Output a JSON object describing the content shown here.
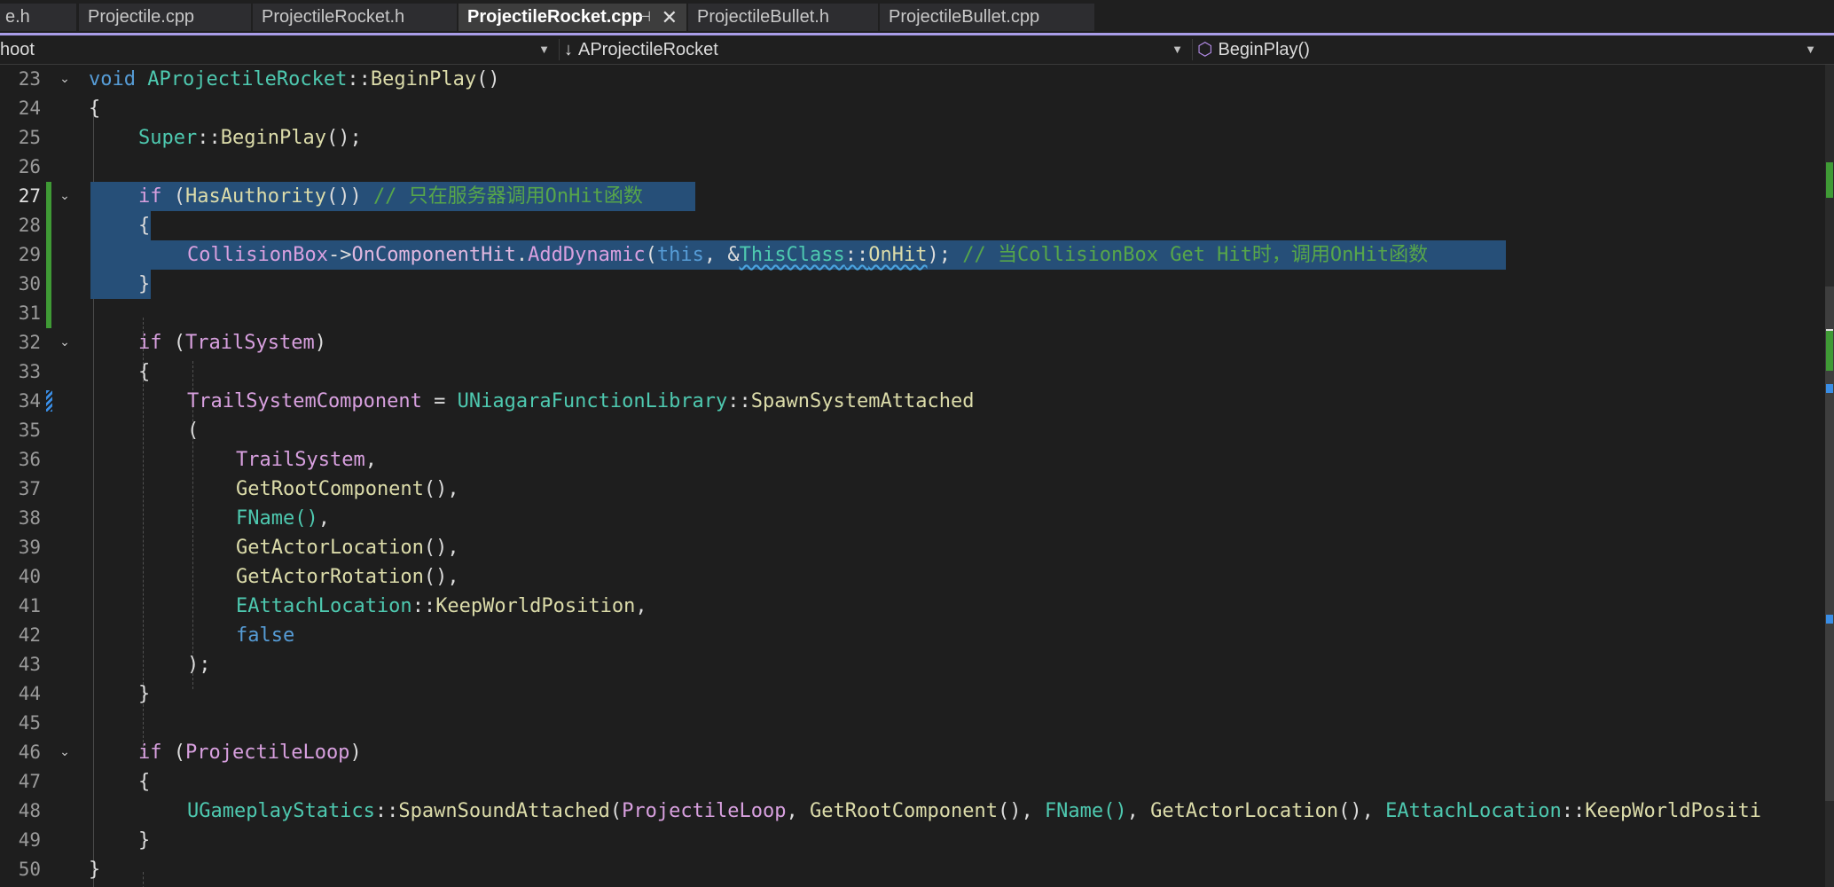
{
  "tabs": [
    {
      "label": "e.h",
      "active": false
    },
    {
      "label": "Projectile.cpp",
      "active": false
    },
    {
      "label": "ProjectileRocket.h",
      "active": false
    },
    {
      "label": "ProjectileRocket.cpp",
      "active": true,
      "pin": "⊣",
      "close": "✕"
    },
    {
      "label": "ProjectileBullet.h",
      "active": false
    },
    {
      "label": "ProjectileBullet.cpp",
      "active": false
    }
  ],
  "navbar": {
    "project": "hoot",
    "class_icon": "↓",
    "class_scope": "AProjectileRocket",
    "member_icon": "⬡",
    "member": "BeginPlay()"
  },
  "lines": [
    {
      "num": "23",
      "fold": "⌄"
    },
    {
      "num": "24"
    },
    {
      "num": "25"
    },
    {
      "num": "26"
    },
    {
      "num": "27",
      "fold": "⌄",
      "current": true
    },
    {
      "num": "28"
    },
    {
      "num": "29"
    },
    {
      "num": "30"
    },
    {
      "num": "31"
    },
    {
      "num": "32",
      "fold": "⌄"
    },
    {
      "num": "33"
    },
    {
      "num": "34"
    },
    {
      "num": "35"
    },
    {
      "num": "36"
    },
    {
      "num": "37"
    },
    {
      "num": "38"
    },
    {
      "num": "39"
    },
    {
      "num": "40"
    },
    {
      "num": "41"
    },
    {
      "num": "42"
    },
    {
      "num": "43"
    },
    {
      "num": "44"
    },
    {
      "num": "45"
    },
    {
      "num": "46",
      "fold": "⌄"
    },
    {
      "num": "47"
    },
    {
      "num": "48"
    },
    {
      "num": "49"
    },
    {
      "num": "50"
    }
  ],
  "code": {
    "l23": [
      "void",
      " ",
      "AProjectileRocket",
      "::",
      "BeginPlay",
      "()"
    ],
    "l24": [
      "{"
    ],
    "l25": [
      "Super",
      "::",
      "BeginPlay",
      "();"
    ],
    "l27": [
      "if",
      " (",
      "HasAuthority",
      "()) ",
      "// 只在服务器调用OnHit函数"
    ],
    "l28": [
      "{"
    ],
    "l29": [
      "CollisionBox",
      "->",
      "OnComponentHit",
      ".",
      "AddDynamic",
      "(",
      "this",
      ", &",
      "ThisClass",
      "::",
      "OnHit",
      "); ",
      "// 当CollisionBox Get Hit时，调用OnHit函数"
    ],
    "l30": [
      "}"
    ],
    "l32": [
      "if",
      " (",
      "TrailSystem",
      ")"
    ],
    "l33": [
      "{"
    ],
    "l34": [
      "TrailSystemComponent",
      " = ",
      "UNiagaraFunctionLibrary",
      "::",
      "SpawnSystemAttached"
    ],
    "l35": [
      "("
    ],
    "l36": [
      "TrailSystem",
      ","
    ],
    "l37": [
      "GetRootComponent",
      "(),"
    ],
    "l38": [
      "FName",
      "()",
      ","
    ],
    "l39": [
      "GetActorLocation",
      "(),"
    ],
    "l40": [
      "GetActorRotation",
      "(),"
    ],
    "l41": [
      "EAttachLocation",
      "::",
      "KeepWorldPosition",
      ","
    ],
    "l42": [
      "false"
    ],
    "l43": [
      ");"
    ],
    "l44": [
      "}"
    ],
    "l46": [
      "if",
      " (",
      "ProjectileLoop",
      ")"
    ],
    "l47": [
      "{"
    ],
    "l48": [
      "UGameplayStatics",
      "::",
      "SpawnSoundAttached",
      "(",
      "ProjectileLoop",
      ", ",
      "GetRootComponent",
      "(), ",
      "FName",
      "()",
      ", ",
      "GetActorLocation",
      "(), ",
      "EAttachLocation",
      "::",
      "KeepWorldPositi"
    ],
    "l49": [
      "}"
    ],
    "l50": [
      "}"
    ]
  },
  "colors": {
    "background": "#1e1e1e",
    "selection": "#264f78",
    "tab_accent": "#a99de8",
    "change_mark": "#3f9a35",
    "keyword": "#569cd6",
    "type": "#4ec9b0",
    "function": "#dcdcaa",
    "variable": "#d8a0df",
    "comment": "#57a64a"
  }
}
